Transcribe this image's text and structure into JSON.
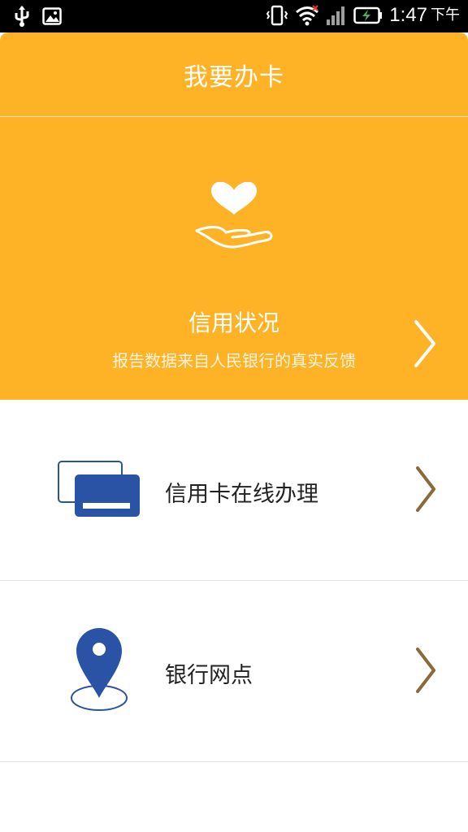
{
  "status_bar": {
    "time": "1:47",
    "ampm": "下午",
    "icons": [
      "usb-icon",
      "image-icon",
      "vibrate-icon",
      "wifi-icon",
      "signal-icon",
      "battery-charging-icon"
    ]
  },
  "header": {
    "title": "我要办卡"
  },
  "hero": {
    "title": "信用状况",
    "subtitle": "报告数据来自人民银行的真实反馈",
    "icon": "heart-hand-icon",
    "chevron": "chevron-right-icon"
  },
  "menu": [
    {
      "label": "信用卡在线办理",
      "icon": "credit-card-icon"
    },
    {
      "label": "银行网点",
      "icon": "location-pin-icon"
    }
  ],
  "colors": {
    "accent": "#FEB327",
    "icon_blue": "#2A52A5",
    "chevron_brown": "#8B6A3A"
  }
}
